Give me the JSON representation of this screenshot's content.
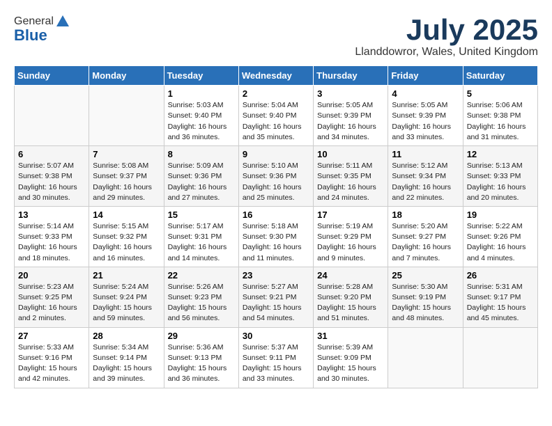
{
  "header": {
    "logo_general": "General",
    "logo_blue": "Blue",
    "month": "July 2025",
    "location": "Llanddowror, Wales, United Kingdom"
  },
  "weekdays": [
    "Sunday",
    "Monday",
    "Tuesday",
    "Wednesday",
    "Thursday",
    "Friday",
    "Saturday"
  ],
  "weeks": [
    [
      {
        "day": "",
        "info": ""
      },
      {
        "day": "",
        "info": ""
      },
      {
        "day": "1",
        "info": "Sunrise: 5:03 AM\nSunset: 9:40 PM\nDaylight: 16 hours\nand 36 minutes."
      },
      {
        "day": "2",
        "info": "Sunrise: 5:04 AM\nSunset: 9:40 PM\nDaylight: 16 hours\nand 35 minutes."
      },
      {
        "day": "3",
        "info": "Sunrise: 5:05 AM\nSunset: 9:39 PM\nDaylight: 16 hours\nand 34 minutes."
      },
      {
        "day": "4",
        "info": "Sunrise: 5:05 AM\nSunset: 9:39 PM\nDaylight: 16 hours\nand 33 minutes."
      },
      {
        "day": "5",
        "info": "Sunrise: 5:06 AM\nSunset: 9:38 PM\nDaylight: 16 hours\nand 31 minutes."
      }
    ],
    [
      {
        "day": "6",
        "info": "Sunrise: 5:07 AM\nSunset: 9:38 PM\nDaylight: 16 hours\nand 30 minutes."
      },
      {
        "day": "7",
        "info": "Sunrise: 5:08 AM\nSunset: 9:37 PM\nDaylight: 16 hours\nand 29 minutes."
      },
      {
        "day": "8",
        "info": "Sunrise: 5:09 AM\nSunset: 9:36 PM\nDaylight: 16 hours\nand 27 minutes."
      },
      {
        "day": "9",
        "info": "Sunrise: 5:10 AM\nSunset: 9:36 PM\nDaylight: 16 hours\nand 25 minutes."
      },
      {
        "day": "10",
        "info": "Sunrise: 5:11 AM\nSunset: 9:35 PM\nDaylight: 16 hours\nand 24 minutes."
      },
      {
        "day": "11",
        "info": "Sunrise: 5:12 AM\nSunset: 9:34 PM\nDaylight: 16 hours\nand 22 minutes."
      },
      {
        "day": "12",
        "info": "Sunrise: 5:13 AM\nSunset: 9:33 PM\nDaylight: 16 hours\nand 20 minutes."
      }
    ],
    [
      {
        "day": "13",
        "info": "Sunrise: 5:14 AM\nSunset: 9:33 PM\nDaylight: 16 hours\nand 18 minutes."
      },
      {
        "day": "14",
        "info": "Sunrise: 5:15 AM\nSunset: 9:32 PM\nDaylight: 16 hours\nand 16 minutes."
      },
      {
        "day": "15",
        "info": "Sunrise: 5:17 AM\nSunset: 9:31 PM\nDaylight: 16 hours\nand 14 minutes."
      },
      {
        "day": "16",
        "info": "Sunrise: 5:18 AM\nSunset: 9:30 PM\nDaylight: 16 hours\nand 11 minutes."
      },
      {
        "day": "17",
        "info": "Sunrise: 5:19 AM\nSunset: 9:29 PM\nDaylight: 16 hours\nand 9 minutes."
      },
      {
        "day": "18",
        "info": "Sunrise: 5:20 AM\nSunset: 9:27 PM\nDaylight: 16 hours\nand 7 minutes."
      },
      {
        "day": "19",
        "info": "Sunrise: 5:22 AM\nSunset: 9:26 PM\nDaylight: 16 hours\nand 4 minutes."
      }
    ],
    [
      {
        "day": "20",
        "info": "Sunrise: 5:23 AM\nSunset: 9:25 PM\nDaylight: 16 hours\nand 2 minutes."
      },
      {
        "day": "21",
        "info": "Sunrise: 5:24 AM\nSunset: 9:24 PM\nDaylight: 15 hours\nand 59 minutes."
      },
      {
        "day": "22",
        "info": "Sunrise: 5:26 AM\nSunset: 9:23 PM\nDaylight: 15 hours\nand 56 minutes."
      },
      {
        "day": "23",
        "info": "Sunrise: 5:27 AM\nSunset: 9:21 PM\nDaylight: 15 hours\nand 54 minutes."
      },
      {
        "day": "24",
        "info": "Sunrise: 5:28 AM\nSunset: 9:20 PM\nDaylight: 15 hours\nand 51 minutes."
      },
      {
        "day": "25",
        "info": "Sunrise: 5:30 AM\nSunset: 9:19 PM\nDaylight: 15 hours\nand 48 minutes."
      },
      {
        "day": "26",
        "info": "Sunrise: 5:31 AM\nSunset: 9:17 PM\nDaylight: 15 hours\nand 45 minutes."
      }
    ],
    [
      {
        "day": "27",
        "info": "Sunrise: 5:33 AM\nSunset: 9:16 PM\nDaylight: 15 hours\nand 42 minutes."
      },
      {
        "day": "28",
        "info": "Sunrise: 5:34 AM\nSunset: 9:14 PM\nDaylight: 15 hours\nand 39 minutes."
      },
      {
        "day": "29",
        "info": "Sunrise: 5:36 AM\nSunset: 9:13 PM\nDaylight: 15 hours\nand 36 minutes."
      },
      {
        "day": "30",
        "info": "Sunrise: 5:37 AM\nSunset: 9:11 PM\nDaylight: 15 hours\nand 33 minutes."
      },
      {
        "day": "31",
        "info": "Sunrise: 5:39 AM\nSunset: 9:09 PM\nDaylight: 15 hours\nand 30 minutes."
      },
      {
        "day": "",
        "info": ""
      },
      {
        "day": "",
        "info": ""
      }
    ]
  ]
}
